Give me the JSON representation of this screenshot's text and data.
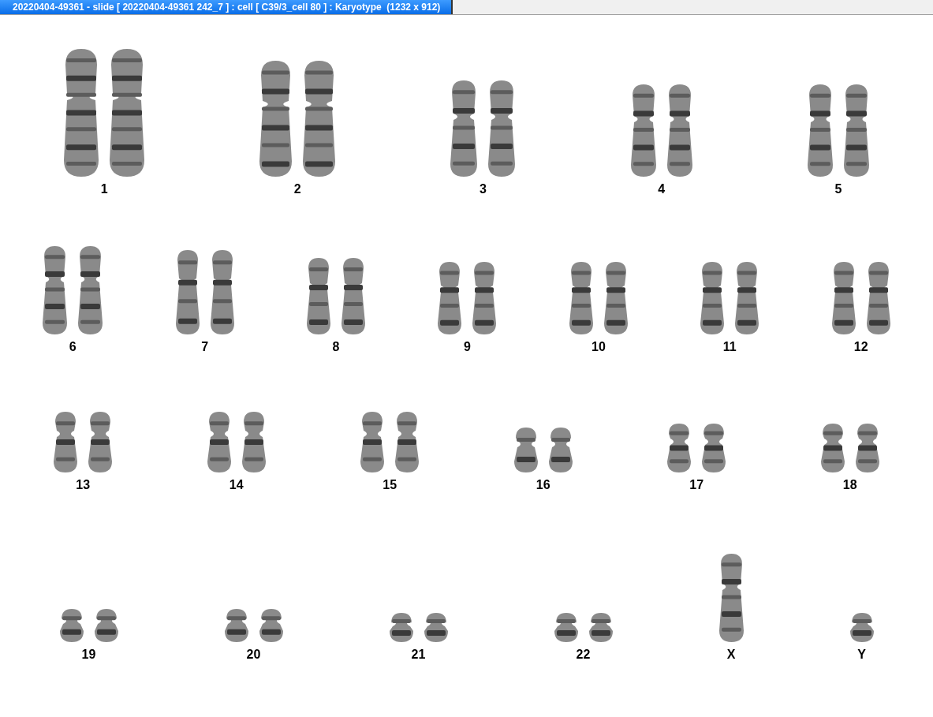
{
  "window": {
    "title": "20220404-49361 - slide [ 20220404-49361 242_7 ] : cell [ C39/3_cell 80 ] : Karyotype  (1232 x 912)"
  },
  "karyotype": {
    "rows": [
      {
        "groups": [
          {
            "label": "1",
            "kind": "pair"
          },
          {
            "label": "2",
            "kind": "pair"
          },
          {
            "label": "3",
            "kind": "pair"
          },
          {
            "label": "4",
            "kind": "pair"
          },
          {
            "label": "5",
            "kind": "pair"
          }
        ]
      },
      {
        "groups": [
          {
            "label": "6",
            "kind": "pair"
          },
          {
            "label": "7",
            "kind": "pair"
          },
          {
            "label": "8",
            "kind": "pair"
          },
          {
            "label": "9",
            "kind": "pair"
          },
          {
            "label": "10",
            "kind": "pair"
          },
          {
            "label": "11",
            "kind": "pair"
          },
          {
            "label": "12",
            "kind": "pair"
          }
        ]
      },
      {
        "groups": [
          {
            "label": "13",
            "kind": "pair"
          },
          {
            "label": "14",
            "kind": "pair"
          },
          {
            "label": "15",
            "kind": "pair"
          },
          {
            "label": "16",
            "kind": "pair"
          },
          {
            "label": "17",
            "kind": "pair"
          },
          {
            "label": "18",
            "kind": "pair"
          }
        ]
      },
      {
        "groups": [
          {
            "label": "19",
            "kind": "pair"
          },
          {
            "label": "20",
            "kind": "pair"
          },
          {
            "label": "21",
            "kind": "pair"
          },
          {
            "label": "22",
            "kind": "pair"
          },
          {
            "label": "X",
            "kind": "single"
          },
          {
            "label": "Y",
            "kind": "single"
          }
        ]
      }
    ]
  }
}
